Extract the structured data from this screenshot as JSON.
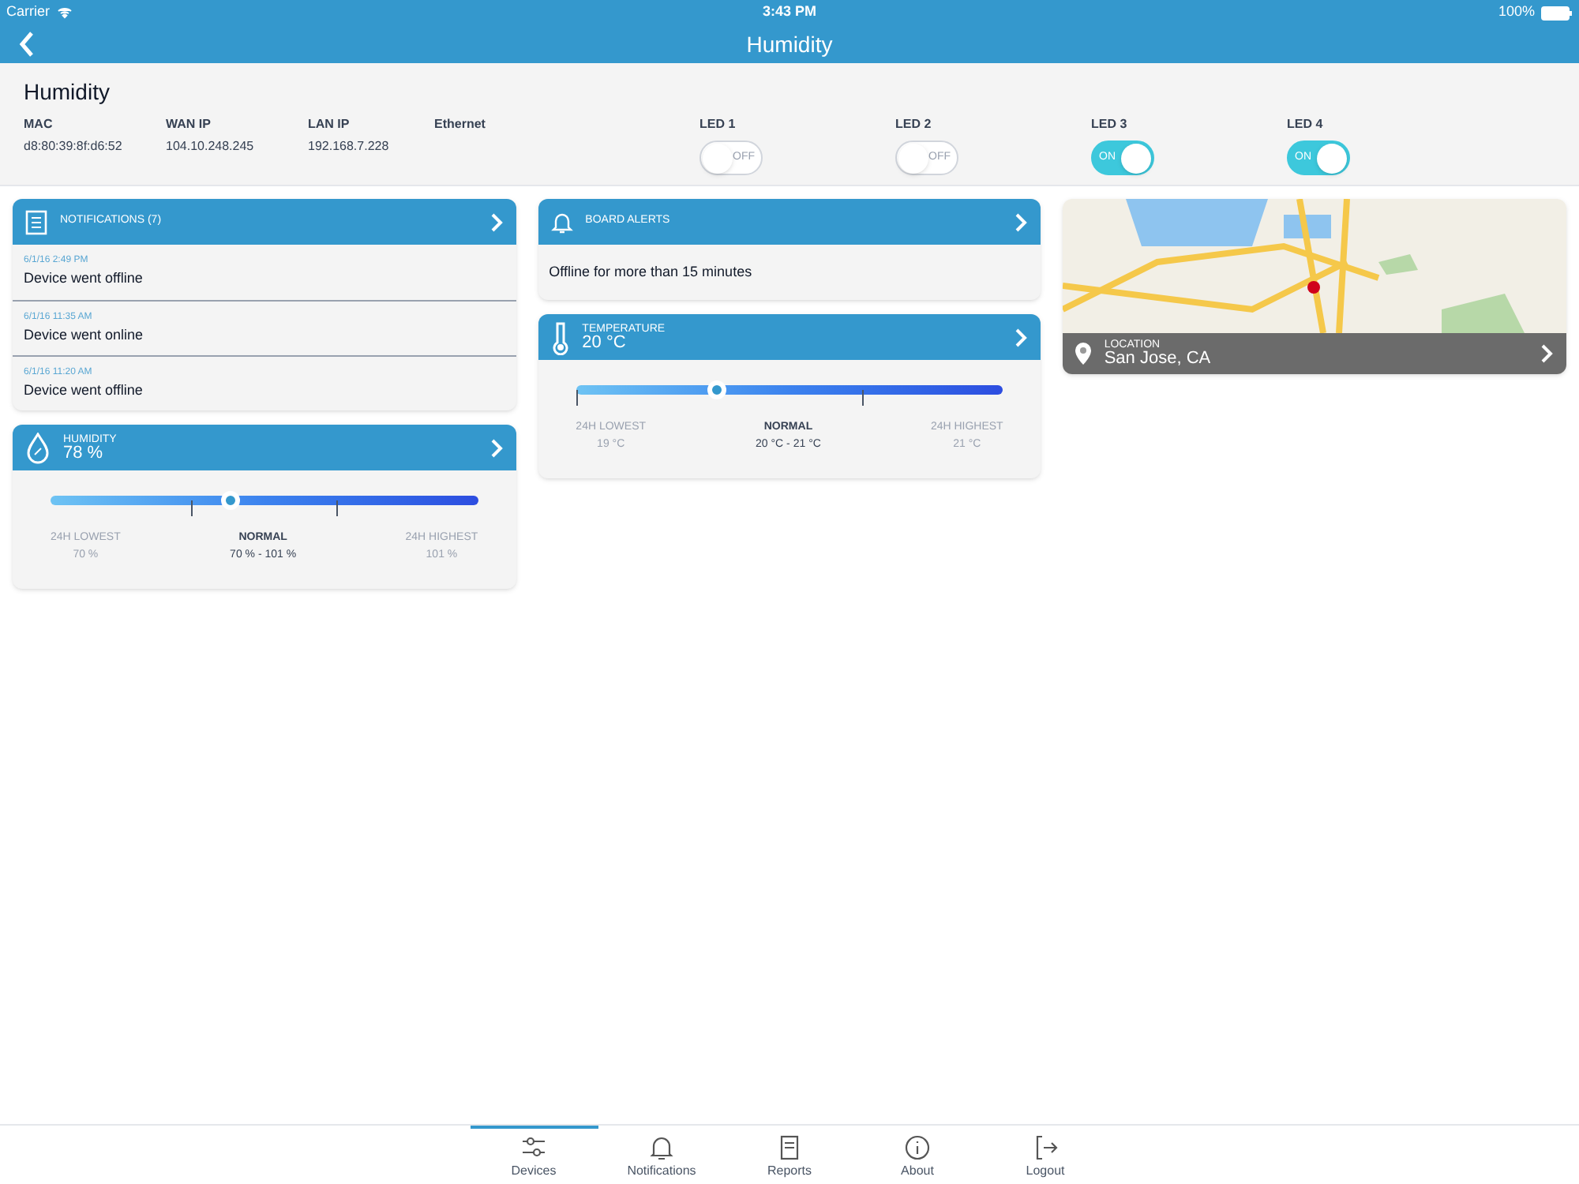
{
  "status_bar": {
    "carrier": "Carrier",
    "time": "3:43 PM",
    "battery": "100%"
  },
  "nav": {
    "title": "Humidity"
  },
  "device": {
    "name": "Humidity",
    "fields": [
      {
        "label": "MAC",
        "value": "d8:80:39:8f:d6:52"
      },
      {
        "label": "WAN IP",
        "value": "104.10.248.245"
      },
      {
        "label": "LAN IP",
        "value": "192.168.7.228"
      },
      {
        "label": "Ethernet"
      }
    ],
    "leds": [
      {
        "label": "LED 1",
        "on": false,
        "text": "OFF"
      },
      {
        "label": "LED 2",
        "on": false,
        "text": "OFF"
      },
      {
        "label": "LED 3",
        "on": true,
        "text": "ON"
      },
      {
        "label": "LED 4",
        "on": true,
        "text": "ON"
      }
    ]
  },
  "notifications": {
    "title": "NOTIFICATIONS (7)",
    "items": [
      {
        "time": "6/1/16 2:49 PM",
        "text": "Device went offline"
      },
      {
        "time": "6/1/16 11:35 AM",
        "text": "Device went online"
      },
      {
        "time": "6/1/16 11:20 AM",
        "text": "Device went offline"
      }
    ]
  },
  "board_alerts": {
    "title": "BOARD ALERTS",
    "text": "Offline for more than 15 minutes"
  },
  "humidity": {
    "kind": "drop",
    "title": "HUMIDITY",
    "value": "78 %",
    "level": 0.42,
    "low_label": "24H LOWEST",
    "low": "70 %",
    "normal_label": "NORMAL",
    "normal": "70 % - 101 %",
    "high_label": "24H HIGHEST",
    "high": "101 %"
  },
  "temperature": {
    "kind": "thermometer",
    "title": "TEMPERATURE",
    "value": "20 °C",
    "level": 0.33,
    "low_label": "24H LOWEST",
    "low": "19 °C",
    "normal_label": "NORMAL",
    "normal": "20 °C - 21 °C",
    "high_label": "24H HIGHEST",
    "high": "21 °C"
  },
  "location": {
    "label": "LOCATION",
    "value": "San Jose, CA"
  },
  "tab_bar": [
    {
      "kind": "sliders",
      "label": "Devices",
      "selected": true
    },
    {
      "kind": "bell",
      "label": "Notifications",
      "selected": false
    },
    {
      "kind": "book",
      "label": "Reports",
      "selected": false
    },
    {
      "kind": "info",
      "label": "About",
      "selected": false
    },
    {
      "kind": "logout",
      "label": "Logout",
      "selected": false
    }
  ]
}
